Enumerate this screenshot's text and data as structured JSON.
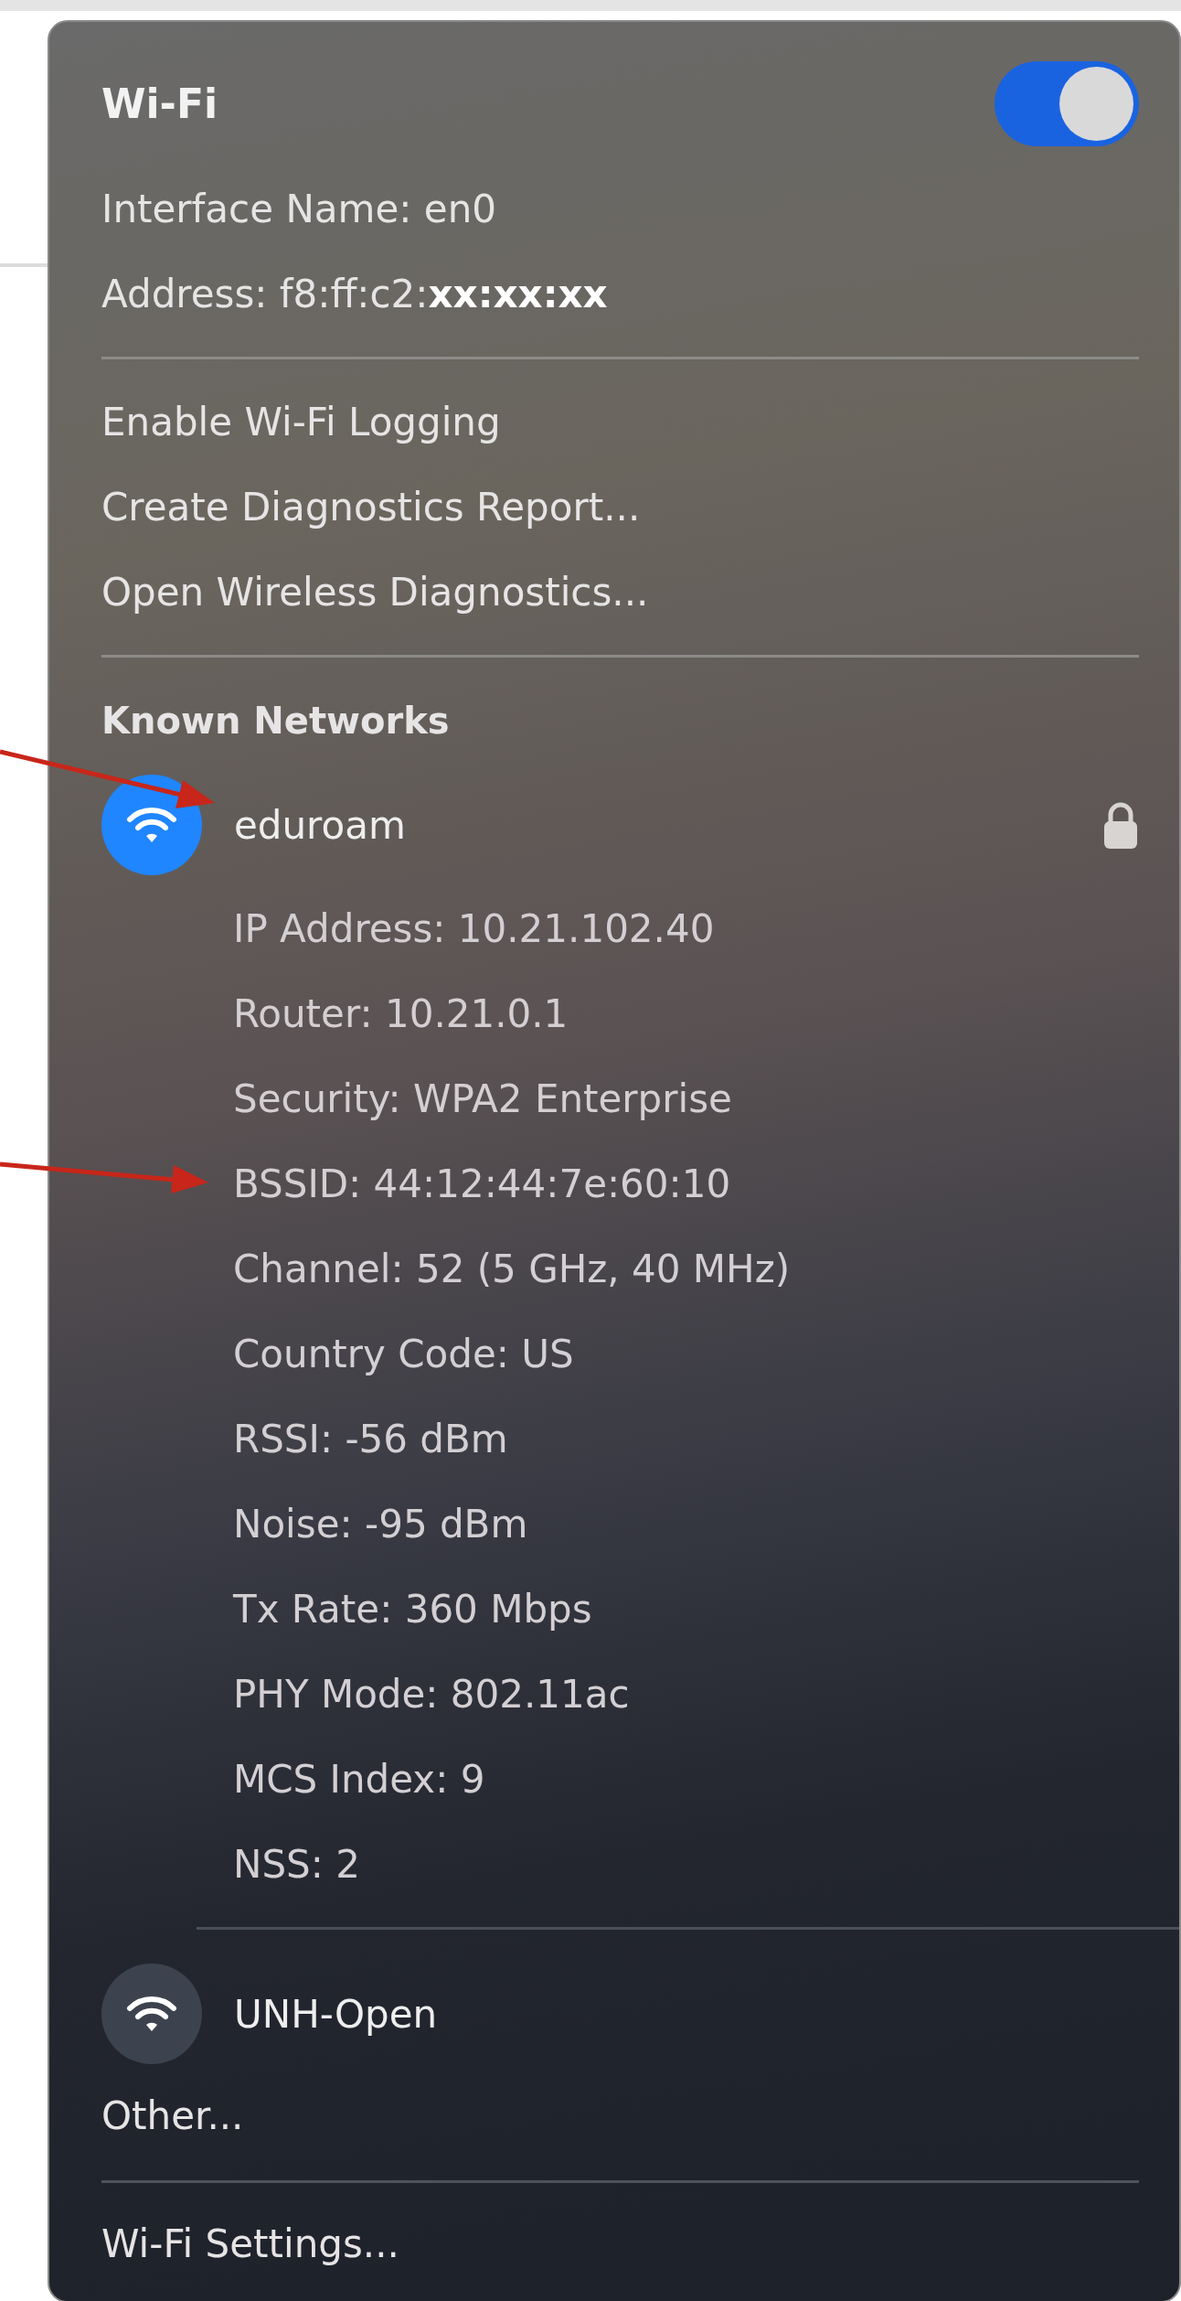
{
  "header": {
    "title": "Wi-Fi",
    "toggle": {
      "on": true
    }
  },
  "interface_info": [
    "Interface Name: en0",
    "Address: f8:ff:c2:**xx:xx:xx**"
  ],
  "actions": [
    "Enable Wi-Fi Logging",
    "Create Diagnostics Report...",
    "Open Wireless Diagnostics..."
  ],
  "known_networks": {
    "heading": "Known Networks",
    "networks": [
      {
        "name": "eduroam",
        "connected": true,
        "secured": true,
        "details": [
          "IP Address: 10.21.102.40",
          "Router: 10.21.0.1",
          "Security: WPA2 Enterprise",
          "BSSID: 44:12:44:7e:60:10",
          "Channel: 52 (5 GHz, 40 MHz)",
          "Country Code: US",
          "RSSI: -56 dBm",
          "Noise: -95 dBm",
          "Tx Rate: 360 Mbps",
          "PHY Mode: 802.11ac",
          "MCS Index: 9",
          "NSS: 2"
        ]
      },
      {
        "name": "UNH-Open",
        "connected": false,
        "secured": false
      }
    ]
  },
  "other": "Other...",
  "settings": "Wi-Fi Settings..."
}
